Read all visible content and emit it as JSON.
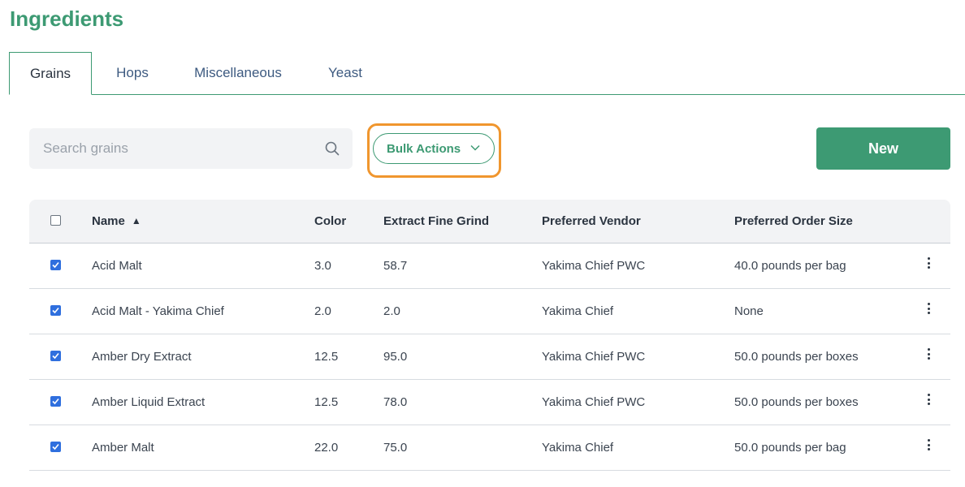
{
  "page": {
    "title": "Ingredients"
  },
  "tabs": [
    {
      "label": "Grains",
      "active": true
    },
    {
      "label": "Hops",
      "active": false
    },
    {
      "label": "Miscellaneous",
      "active": false
    },
    {
      "label": "Yeast",
      "active": false
    }
  ],
  "toolbar": {
    "search_placeholder": "Search grains",
    "search_value": "",
    "bulk_actions_label": "Bulk Actions",
    "new_label": "New"
  },
  "table": {
    "columns": {
      "name": "Name",
      "name_sort": "▲",
      "color": "Color",
      "extract": "Extract Fine Grind",
      "vendor": "Preferred Vendor",
      "order_size": "Preferred Order Size"
    },
    "select_all_checked": false,
    "rows": [
      {
        "checked": true,
        "name": "Acid Malt",
        "color": "3.0",
        "extract": "58.7",
        "vendor": "Yakima Chief PWC",
        "order_size": "40.0 pounds per bag"
      },
      {
        "checked": true,
        "name": "Acid Malt - Yakima Chief",
        "color": "2.0",
        "extract": "2.0",
        "vendor": "Yakima Chief",
        "order_size": "None"
      },
      {
        "checked": true,
        "name": "Amber Dry Extract",
        "color": "12.5",
        "extract": "95.0",
        "vendor": "Yakima Chief PWC",
        "order_size": "50.0 pounds per boxes"
      },
      {
        "checked": true,
        "name": "Amber Liquid Extract",
        "color": "12.5",
        "extract": "78.0",
        "vendor": "Yakima Chief PWC",
        "order_size": "50.0 pounds per boxes"
      },
      {
        "checked": true,
        "name": "Amber Malt",
        "color": "22.0",
        "extract": "75.0",
        "vendor": "Yakima Chief",
        "order_size": "50.0 pounds per bag"
      }
    ]
  },
  "colors": {
    "brand_green": "#3d9a73",
    "highlight_orange": "#f0962e",
    "checkbox_blue": "#2f6fde"
  }
}
